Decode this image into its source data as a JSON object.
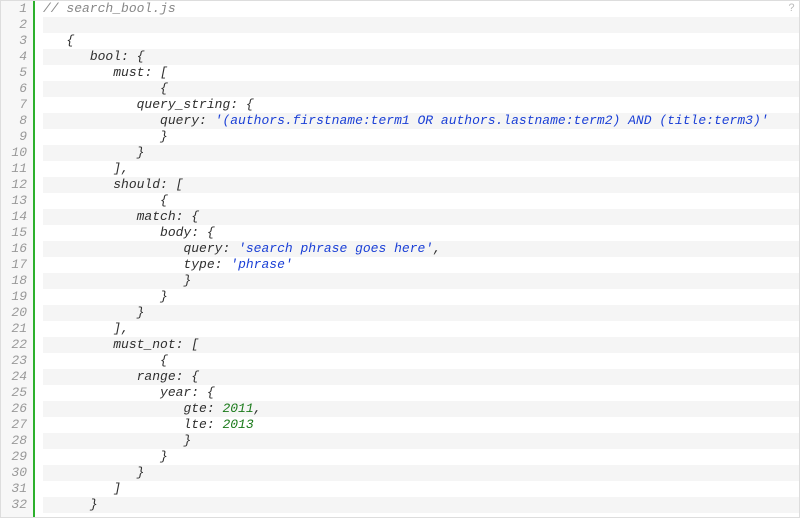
{
  "help_icon": "?",
  "lines": [
    {
      "n": 1,
      "stripe": false,
      "indent": 0,
      "tokens": [
        {
          "t": "comment",
          "v": "// search_bool.js"
        }
      ]
    },
    {
      "n": 2,
      "stripe": true,
      "indent": 0,
      "tokens": []
    },
    {
      "n": 3,
      "stripe": false,
      "indent": 1,
      "tokens": [
        {
          "t": "punct",
          "v": "{"
        }
      ]
    },
    {
      "n": 4,
      "stripe": true,
      "indent": 2,
      "tokens": [
        {
          "t": "key",
          "v": "bool"
        },
        {
          "t": "punct",
          "v": ": {"
        }
      ]
    },
    {
      "n": 5,
      "stripe": false,
      "indent": 3,
      "tokens": [
        {
          "t": "key",
          "v": "must"
        },
        {
          "t": "punct",
          "v": ": ["
        }
      ]
    },
    {
      "n": 6,
      "stripe": true,
      "indent": 5,
      "tokens": [
        {
          "t": "punct",
          "v": "{"
        }
      ]
    },
    {
      "n": 7,
      "stripe": false,
      "indent": 4,
      "tokens": [
        {
          "t": "key",
          "v": "query_string"
        },
        {
          "t": "punct",
          "v": ": {"
        }
      ]
    },
    {
      "n": 8,
      "stripe": true,
      "indent": 5,
      "tokens": [
        {
          "t": "key",
          "v": "query"
        },
        {
          "t": "punct",
          "v": ": "
        },
        {
          "t": "string",
          "v": "'(authors.firstname:term1 OR authors.lastname:term2) AND (title:term3)'"
        }
      ]
    },
    {
      "n": 9,
      "stripe": false,
      "indent": 5,
      "tokens": [
        {
          "t": "punct",
          "v": "}"
        }
      ]
    },
    {
      "n": 10,
      "stripe": true,
      "indent": 4,
      "tokens": [
        {
          "t": "punct",
          "v": "}"
        }
      ]
    },
    {
      "n": 11,
      "stripe": false,
      "indent": 3,
      "tokens": [
        {
          "t": "punct",
          "v": "],"
        }
      ]
    },
    {
      "n": 12,
      "stripe": true,
      "indent": 3,
      "tokens": [
        {
          "t": "key",
          "v": "should"
        },
        {
          "t": "punct",
          "v": ": ["
        }
      ]
    },
    {
      "n": 13,
      "stripe": false,
      "indent": 5,
      "tokens": [
        {
          "t": "punct",
          "v": "{"
        }
      ]
    },
    {
      "n": 14,
      "stripe": true,
      "indent": 4,
      "tokens": [
        {
          "t": "key",
          "v": "match"
        },
        {
          "t": "punct",
          "v": ": {"
        }
      ]
    },
    {
      "n": 15,
      "stripe": false,
      "indent": 5,
      "tokens": [
        {
          "t": "key",
          "v": "body"
        },
        {
          "t": "punct",
          "v": ": {"
        }
      ]
    },
    {
      "n": 16,
      "stripe": true,
      "indent": 6,
      "tokens": [
        {
          "t": "key",
          "v": "query"
        },
        {
          "t": "punct",
          "v": ": "
        },
        {
          "t": "string",
          "v": "'search phrase goes here'"
        },
        {
          "t": "punct",
          "v": ","
        }
      ]
    },
    {
      "n": 17,
      "stripe": false,
      "indent": 6,
      "tokens": [
        {
          "t": "key",
          "v": "type"
        },
        {
          "t": "punct",
          "v": ": "
        },
        {
          "t": "string",
          "v": "'phrase'"
        }
      ]
    },
    {
      "n": 18,
      "stripe": true,
      "indent": 6,
      "tokens": [
        {
          "t": "punct",
          "v": "}"
        }
      ]
    },
    {
      "n": 19,
      "stripe": false,
      "indent": 5,
      "tokens": [
        {
          "t": "punct",
          "v": "}"
        }
      ]
    },
    {
      "n": 20,
      "stripe": true,
      "indent": 4,
      "tokens": [
        {
          "t": "punct",
          "v": "}"
        }
      ]
    },
    {
      "n": 21,
      "stripe": false,
      "indent": 3,
      "tokens": [
        {
          "t": "punct",
          "v": "],"
        }
      ]
    },
    {
      "n": 22,
      "stripe": true,
      "indent": 3,
      "tokens": [
        {
          "t": "key",
          "v": "must_not"
        },
        {
          "t": "punct",
          "v": ": ["
        }
      ]
    },
    {
      "n": 23,
      "stripe": false,
      "indent": 5,
      "tokens": [
        {
          "t": "punct",
          "v": "{"
        }
      ]
    },
    {
      "n": 24,
      "stripe": true,
      "indent": 4,
      "tokens": [
        {
          "t": "key",
          "v": "range"
        },
        {
          "t": "punct",
          "v": ": {"
        }
      ]
    },
    {
      "n": 25,
      "stripe": false,
      "indent": 5,
      "tokens": [
        {
          "t": "key",
          "v": "year"
        },
        {
          "t": "punct",
          "v": ": {"
        }
      ]
    },
    {
      "n": 26,
      "stripe": true,
      "indent": 6,
      "tokens": [
        {
          "t": "key",
          "v": "gte"
        },
        {
          "t": "punct",
          "v": ": "
        },
        {
          "t": "num",
          "v": "2011"
        },
        {
          "t": "punct",
          "v": ","
        }
      ]
    },
    {
      "n": 27,
      "stripe": false,
      "indent": 6,
      "tokens": [
        {
          "t": "key",
          "v": "lte"
        },
        {
          "t": "punct",
          "v": ": "
        },
        {
          "t": "num",
          "v": "2013"
        }
      ]
    },
    {
      "n": 28,
      "stripe": true,
      "indent": 6,
      "tokens": [
        {
          "t": "punct",
          "v": "}"
        }
      ]
    },
    {
      "n": 29,
      "stripe": false,
      "indent": 5,
      "tokens": [
        {
          "t": "punct",
          "v": "}"
        }
      ]
    },
    {
      "n": 30,
      "stripe": true,
      "indent": 4,
      "tokens": [
        {
          "t": "punct",
          "v": "}"
        }
      ]
    },
    {
      "n": 31,
      "stripe": false,
      "indent": 3,
      "tokens": [
        {
          "t": "punct",
          "v": "]"
        }
      ]
    },
    {
      "n": 32,
      "stripe": true,
      "indent": 2,
      "tokens": [
        {
          "t": "punct",
          "v": "}"
        }
      ]
    }
  ]
}
